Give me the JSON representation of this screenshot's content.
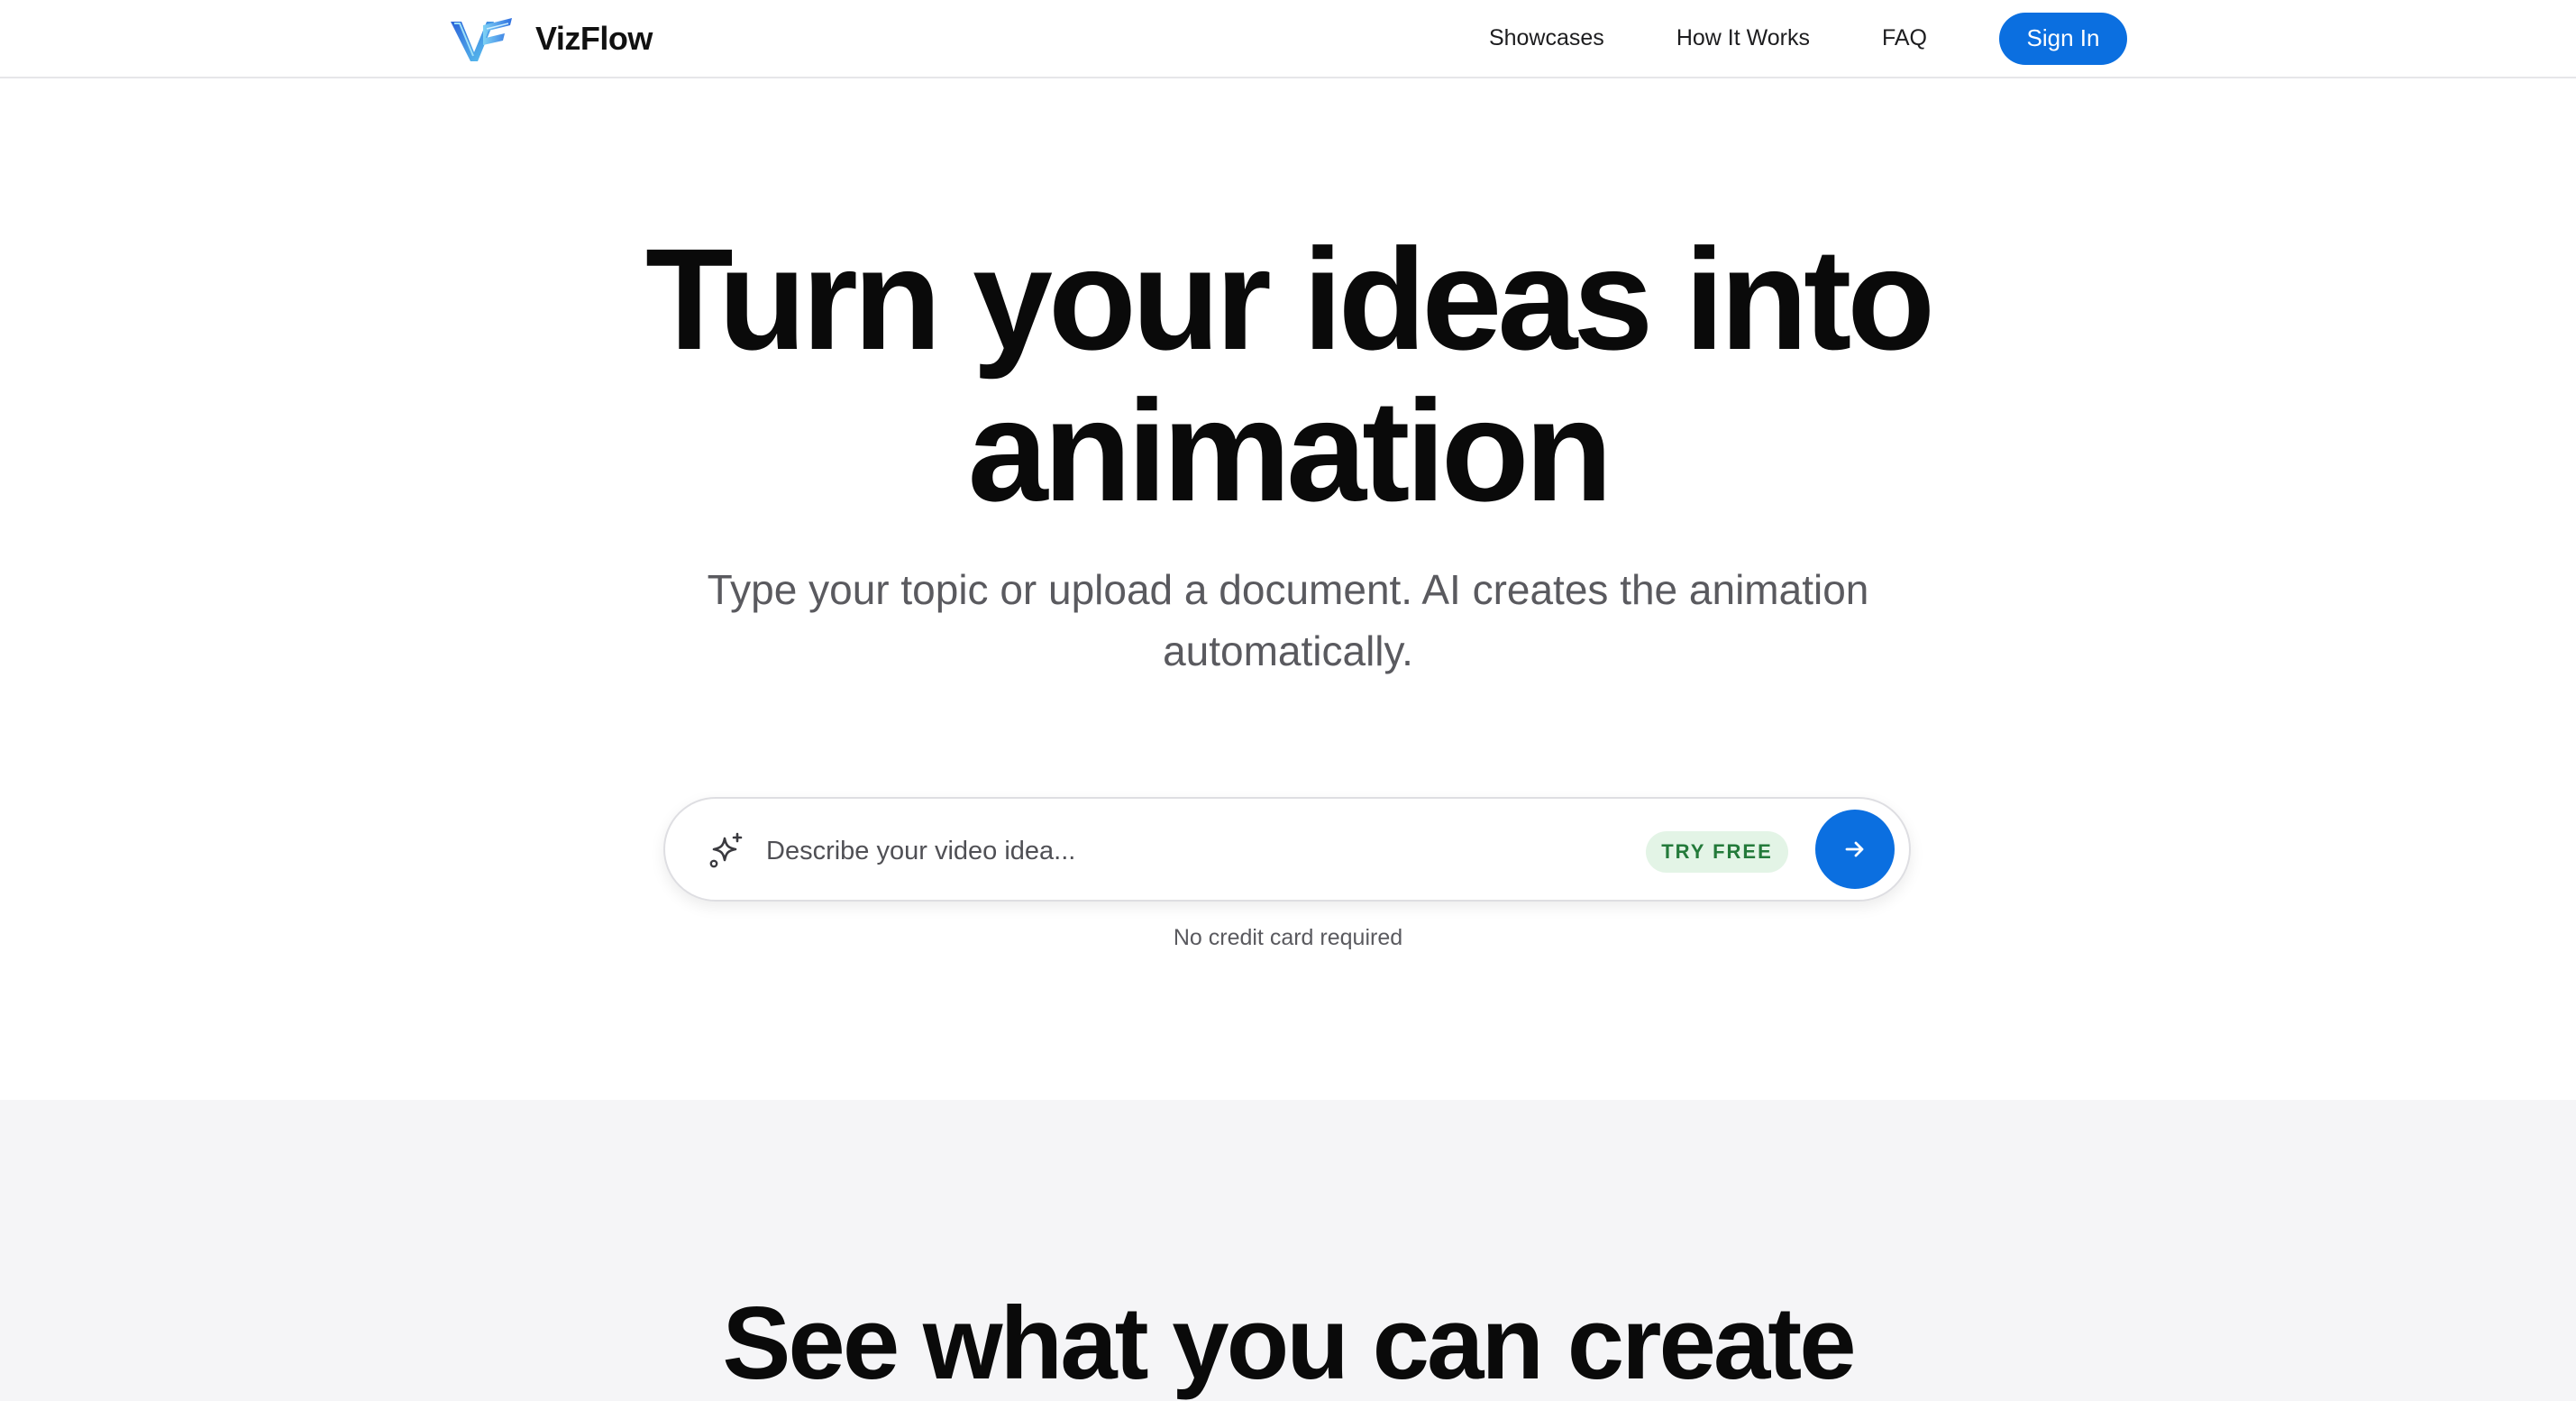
{
  "brand": {
    "name": "VizFlow",
    "logo_icon": "vf-logo-icon"
  },
  "nav": {
    "links": [
      {
        "label": "Showcases"
      },
      {
        "label": "How It Works"
      },
      {
        "label": "FAQ"
      }
    ],
    "signin_label": "Sign In"
  },
  "hero": {
    "title_line1": "Turn your ideas into",
    "title_line2": "animation",
    "subtitle_line1": "Type your topic or upload a document. AI creates the animation",
    "subtitle_line2": "automatically."
  },
  "prompt": {
    "placeholder": "Describe your video idea...",
    "value": "",
    "badge": "TRY FREE",
    "leading_icon": "sparkle-icon",
    "submit_icon": "arrow-right-icon",
    "note": "No credit card required"
  },
  "showcase": {
    "title": "See what you can create"
  },
  "colors": {
    "accent": "#0b6fe0",
    "badge_bg": "#e3f4e6",
    "badge_text": "#237a3a",
    "section_bg": "#f5f5f7"
  }
}
